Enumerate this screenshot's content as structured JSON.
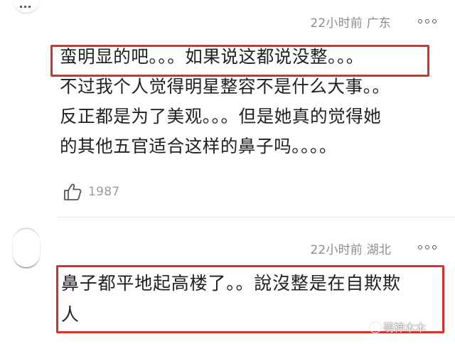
{
  "comments": [
    {
      "time": "22小时前",
      "location": "广东",
      "lines": [
        "蛮明显的吧。。。如果说这都说没整。。。",
        "不过我个人觉得明星整容不是什么大事。。",
        "反正都是为了美观。。。但是她真的觉得她",
        "的其他五官适合这样的鼻子吗。。。。"
      ],
      "likes": "1987"
    },
    {
      "time": "22小时前",
      "location": "湖北",
      "lines": [
        "鼻子都平地起高楼了。。說沒整是在自欺欺",
        "人"
      ]
    }
  ],
  "watermark": "萌神木木",
  "icons": {
    "more": "more-options-icon",
    "like": "thumbs-up-icon",
    "watermark": "platform-logo-icon"
  },
  "colors": {
    "highlight": "#d9302d",
    "meta_text": "#8c8c8c",
    "body_text": "#202020"
  }
}
